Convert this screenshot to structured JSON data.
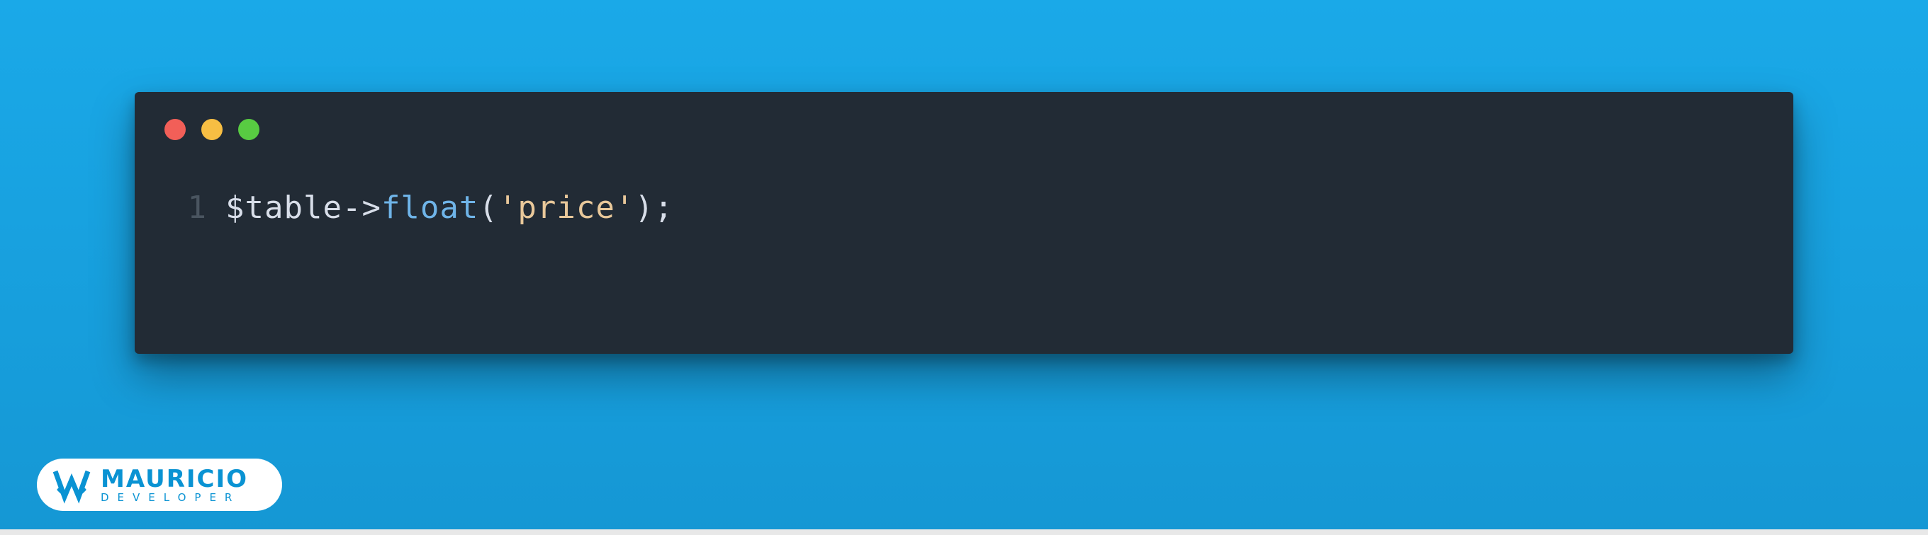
{
  "code": {
    "line_number": "1",
    "tokens": {
      "var": "$table",
      "arrow": "->",
      "func": "float",
      "open": "(",
      "string": "'price'",
      "close": ")",
      "semi": ";"
    }
  },
  "window": {
    "red": "close",
    "yellow": "minimize",
    "green": "zoom"
  },
  "logo": {
    "name": "MAURICIO",
    "subtitle": "DEVELOPER"
  },
  "colors": {
    "bg_top": "#1aa9e8",
    "bg_bottom": "#1597d4",
    "editor": "#222b35",
    "accent_blue": "#0a93d3",
    "token_func": "#6fb4e8",
    "token_string": "#e9c89a",
    "token_default": "#d8dee9"
  }
}
